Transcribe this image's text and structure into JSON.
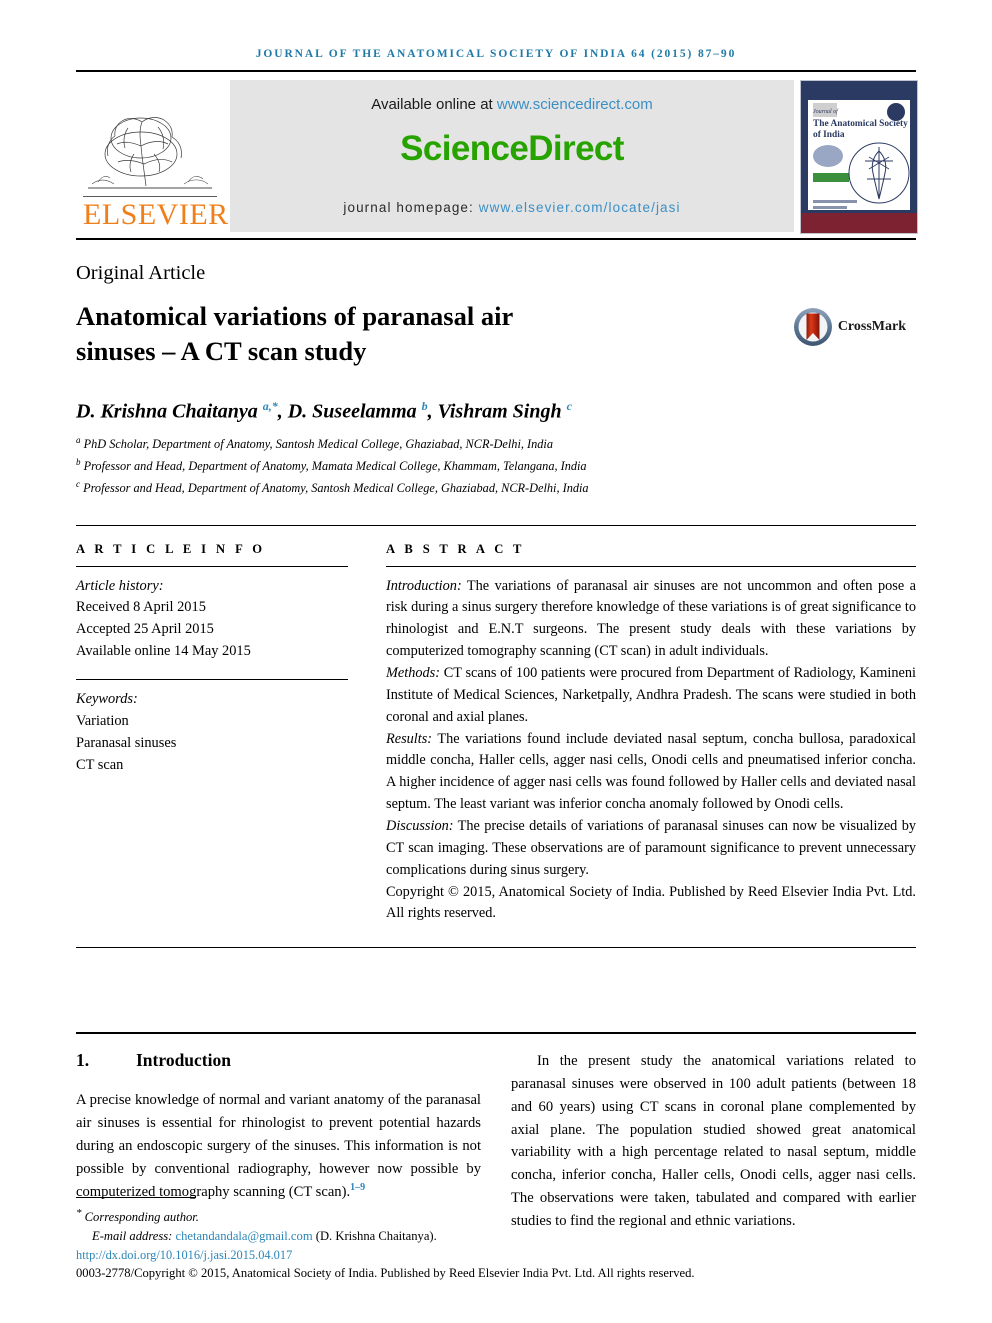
{
  "running_head": "Journal of the Anatomical Society of India 64 (2015) 87–90",
  "banner": {
    "available_prefix": "Available online at ",
    "available_link": "www.sciencedirect.com",
    "sciencedirect_logo": "ScienceDirect",
    "homepage_prefix": "journal homepage: ",
    "homepage_link": "www.elsevier.com/locate/jasi",
    "elsevier_wordmark": "ELSEVIER",
    "cover": {
      "journal_of": "Journal of",
      "title_line1": "The Anatomical Society",
      "title_line2": "of India"
    }
  },
  "article": {
    "type": "Original Article",
    "title_line1": "Anatomical variations of paranasal air",
    "title_line2": "sinuses – A CT scan study",
    "crossmark_label": "CrossMark",
    "authors": {
      "a1_name": "D. Krishna Chaitanya ",
      "a1_sup": "a,*",
      "sep1": ", ",
      "a2_name": "D. Suseelamma ",
      "a2_sup": "b",
      "sep2": ", ",
      "a3_name": "Vishram Singh ",
      "a3_sup": "c"
    },
    "affiliations": [
      {
        "mark": "a",
        "text": " PhD Scholar, Department of Anatomy, Santosh Medical College, Ghaziabad, NCR-Delhi, India"
      },
      {
        "mark": "b",
        "text": " Professor and Head, Department of Anatomy, Mamata Medical College, Khammam, Telangana, India"
      },
      {
        "mark": "c",
        "text": " Professor and Head, Department of Anatomy, Santosh Medical College, Ghaziabad, NCR-Delhi, India"
      }
    ]
  },
  "article_info": {
    "heading": "A R T I C L E  I N F O",
    "history_label": "Article history:",
    "received": "Received 8 April 2015",
    "accepted": "Accepted 25 April 2015",
    "available_online": "Available online 14 May 2015",
    "keywords_label": "Keywords:",
    "keywords": [
      "Variation",
      "Paranasal sinuses",
      "CT scan"
    ]
  },
  "abstract": {
    "heading": "A B S T R A C T",
    "introduction_label": "Introduction:",
    "introduction_text": " The variations of paranasal air sinuses are not uncommon and often pose a risk during a sinus surgery therefore knowledge of these variations is of great significance to rhinologist and E.N.T surgeons. The present study deals with these variations by computerized tomography scanning (CT scan) in adult individuals.",
    "methods_label": "Methods:",
    "methods_text": " CT scans of 100 patients were procured from Department of Radiology, Kamineni Institute of Medical Sciences, Narketpally, Andhra Pradesh. The scans were studied in both coronal and axial planes.",
    "results_label": "Results:",
    "results_text": " The variations found include deviated nasal septum, concha bullosa, paradoxical middle concha, Haller cells, agger nasi cells, Onodi cells and pneumatised inferior concha. A higher incidence of agger nasi cells was found followed by Haller cells and deviated nasal septum. The least variant was inferior concha anomaly followed by Onodi cells.",
    "discussion_label": "Discussion:",
    "discussion_text": " The precise details of variations of paranasal sinuses can now be visualized by CT scan imaging. These observations are of paramount significance to prevent unnecessary complications during sinus surgery.",
    "copyright": "Copyright © 2015, Anatomical Society of India. Published by Reed Elsevier India Pvt. Ltd. All rights reserved."
  },
  "body": {
    "section_number": "1.",
    "section_title": "Introduction",
    "left_paragraph_part1": "A precise knowledge of normal and variant anatomy of the paranasal air sinuses is essential for rhinologist to prevent potential hazards during an endoscopic surgery of the sinuses. This information is not possible by conventional radiography, however now possible by computerized tomography scanning (CT scan).",
    "left_paragraph_ref": "1–9",
    "right_paragraph": "In the present study the anatomical variations related to paranasal sinuses were observed in 100 adult patients (between 18 and 60 years) using CT scans in coronal plane complemented by axial plane. The population studied showed great anatomical variability with a high percentage related to nasal septum, middle concha, inferior concha, Haller cells, Onodi cells, agger nasi cells. The observations were taken, tabulated and compared with earlier studies to find the regional and ethnic variations."
  },
  "footnote": {
    "corresponding_marker": "*",
    "corresponding_text": " Corresponding author.",
    "email_label": "E-mail address: ",
    "email": "chetandandala@gmail.com",
    "email_suffix": " (D. Krishna Chaitanya).",
    "doi": "http://dx.doi.org/10.1016/j.jasi.2015.04.017",
    "issn_line": "0003-2778/Copyright © 2015, Anatomical Society of India. Published by Reed Elsevier India Pvt. Ltd. All rights reserved."
  },
  "colors": {
    "running_head": "#1f7aa8",
    "link": "#2d86b8",
    "sciencedirect_green": "#27a300",
    "elsevier_orange": "#F07F19",
    "cover_navy": "#2b3a62"
  }
}
